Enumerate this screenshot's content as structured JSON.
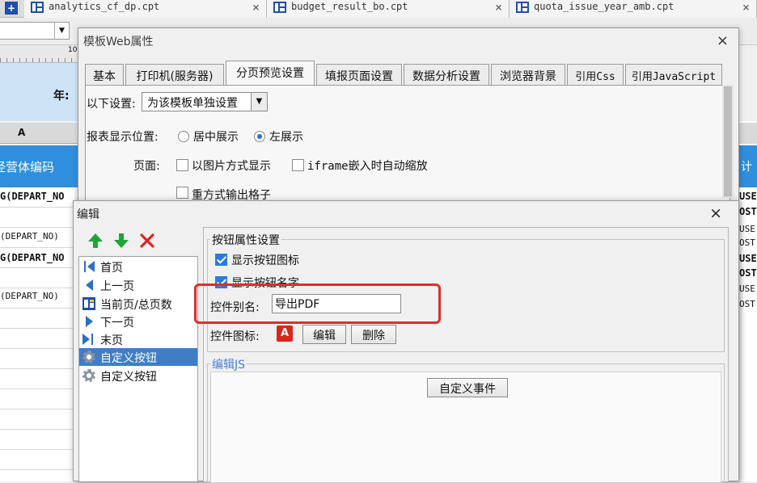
{
  "file_tabs": [
    {
      "name": "analytics_cf_dp.cpt",
      "close": "×"
    },
    {
      "name": "budget_result_bo.cpt",
      "close": "×"
    },
    {
      "name": "quota_issue_year_amb.cpt",
      "close": "×"
    }
  ],
  "background": {
    "toolbar_combo": "",
    "ruler_mark": "10",
    "year_label": "年:",
    "column_header": "A",
    "header_cell": "经营体编码",
    "rows": [
      "G(DEPART_NO",
      "(DEPART_NO)",
      "G(DEPART_NO",
      "(DEPART_NO)"
    ],
    "right_header": "计",
    "right_rows": [
      "USE",
      "OST",
      "USE",
      "OST",
      "USE",
      "OST",
      "USE",
      "OST"
    ]
  },
  "web_dialog": {
    "title": "模板Web属性",
    "close": "×",
    "tabs": [
      "基本",
      "打印机(服务器)",
      "分页预览设置",
      "填报页面设置",
      "数据分析设置",
      "浏览器背景",
      "引用Css",
      "引用JavaScript"
    ],
    "active_tab": 2,
    "settings_label": "以下设置:",
    "settings_value": "为该模板单独设置",
    "position_label": "报表显示位置:",
    "position_options": [
      "居中展示",
      "左展示"
    ],
    "position_selected": "左展示",
    "page_label": "页面:",
    "page_options": [
      "以图片方式显示",
      "iframe嵌入时自动缩放",
      "重方式输出格子"
    ]
  },
  "edit_dialog": {
    "title": "编辑",
    "close": "×",
    "toolbar": {
      "up": "move-up",
      "down": "move-down",
      "delete": "delete"
    },
    "list_items": [
      {
        "label": "首页",
        "icon": "first-page-icon"
      },
      {
        "label": "上一页",
        "icon": "previous-page-icon"
      },
      {
        "label": "当前页/总页数",
        "icon": "page-count-icon"
      },
      {
        "label": "下一页",
        "icon": "next-page-icon"
      },
      {
        "label": "末页",
        "icon": "last-page-icon"
      },
      {
        "label": "自定义按钮",
        "icon": "gear-icon"
      },
      {
        "label": "自定义按钮",
        "icon": "gear-icon"
      }
    ],
    "selected_index": 5,
    "button_props": {
      "legend": "按钮属性设置",
      "show_icon": "显示按钮图标",
      "show_name": "显示按钮名字",
      "alias_label": "控件别名:",
      "alias_value": "导出PDF",
      "icon_label": "控件图标:",
      "icon_glyph": "A",
      "edit_button": "编辑",
      "delete_button": "删除"
    },
    "edit_js": {
      "legend": "编辑JS",
      "custom_event_button": "自定义事件"
    },
    "highlight_color": "#e02d2d"
  }
}
